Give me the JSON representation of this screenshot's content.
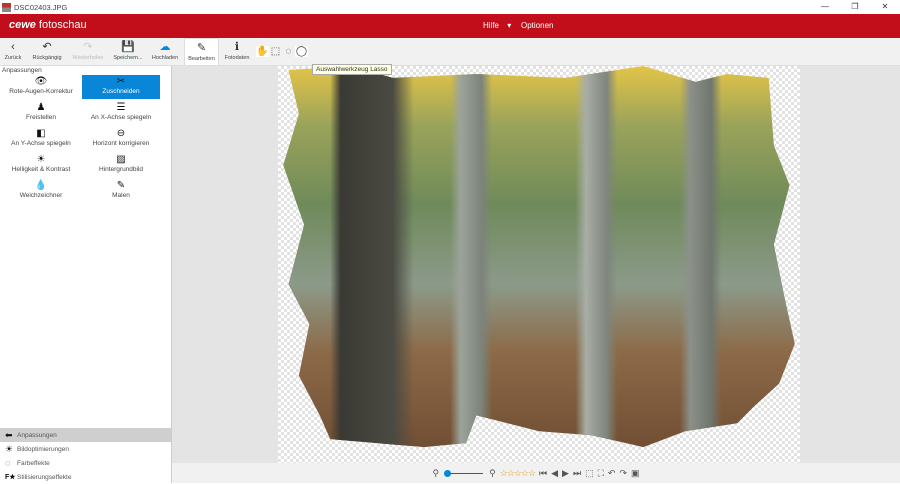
{
  "window": {
    "title": "DSC02403.JPG",
    "controls": [
      "—",
      "❐",
      "✕"
    ]
  },
  "header": {
    "logo_brand": "cewe",
    "logo_text": "fotoschau",
    "menu": [
      {
        "label": "Hilfe",
        "dropdown": "▾"
      },
      {
        "label": "Optionen"
      }
    ],
    "color": "#c20e1a"
  },
  "toolbar": {
    "items": [
      {
        "label": "Zurück",
        "icon": "‹"
      },
      {
        "label": "Rückgängig",
        "icon": "↶"
      },
      {
        "label": "Wiederholen",
        "icon": "↷"
      },
      {
        "label": "Speichern...",
        "icon": "💾"
      },
      {
        "label": "Hochladen",
        "icon": "☁"
      },
      {
        "label": "Bearbeiten",
        "icon": "✎"
      },
      {
        "label": "Fotodaten",
        "icon": "ℹ"
      }
    ],
    "select_tools": [
      "✋",
      "⬚",
      "◌",
      "◯"
    ],
    "tooltip": "Auswahlwerkzeug Lasso"
  },
  "left": {
    "heading": "Anpassungen",
    "tools": [
      {
        "label": "Rote-Augen-Korrektur",
        "icon": "👁"
      },
      {
        "label": "Zuschneiden",
        "icon": "✂"
      },
      {
        "label": "Freistellen",
        "icon": "♟"
      },
      {
        "label": "An X-Achse spiegeln",
        "icon": "☰"
      },
      {
        "label": "An Y-Achse spiegeln",
        "icon": "◧"
      },
      {
        "label": "Horizont korrigieren",
        "icon": "⊖"
      },
      {
        "label": "Helligkeit & Kontrast",
        "icon": "☀"
      },
      {
        "label": "Hintergrundbild",
        "icon": "▨"
      },
      {
        "label": "Weichzeichner",
        "icon": "💧"
      },
      {
        "label": "Malen",
        "icon": "✎"
      }
    ],
    "sections": [
      {
        "label": "Anpassungen",
        "icon": "⬅"
      },
      {
        "label": "Bildoptimierungen",
        "icon": "☀"
      },
      {
        "label": "Farbeffekte",
        "icon": "◌"
      },
      {
        "label": "Stilisierungseffekte",
        "icon": "F★"
      }
    ]
  },
  "bottombar": {
    "stars": "☆☆☆☆☆",
    "rating": 0,
    "zoom_fraction": 0.05,
    "icons": [
      "⏮",
      "◀",
      "▶",
      "⏭",
      "⬚",
      "⛶",
      "↶",
      "↷",
      "▣"
    ]
  }
}
